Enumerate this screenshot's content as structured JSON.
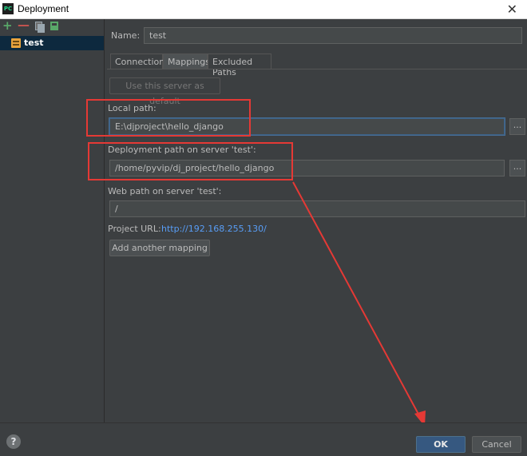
{
  "window": {
    "title": "Deployment",
    "app_icon_text": "PC",
    "close_glyph": "✕"
  },
  "toolbar": {
    "add": "+",
    "remove": "—"
  },
  "tree": {
    "items": [
      {
        "label": "test"
      }
    ]
  },
  "name": {
    "label": "Name:",
    "value": "test"
  },
  "tabs": [
    {
      "label": "Connection",
      "selected": false
    },
    {
      "label": "Mappings",
      "selected": true
    },
    {
      "label": "Excluded Paths",
      "selected": false
    }
  ],
  "use_default_button": "Use this server as default",
  "local_path": {
    "label": "Local path:",
    "value": "E:\\djproject\\hello_django"
  },
  "deployment_path": {
    "label": "Deployment path on server 'test':",
    "value": "/home/pyvip/dj_project/hello_django"
  },
  "web_path": {
    "label": "Web path on server 'test':",
    "value": "/"
  },
  "project_url": {
    "label": "Project URL:",
    "value": "http://192.168.255.130/"
  },
  "add_mapping_button": "Add another mapping",
  "browse_label": "...",
  "footer": {
    "help": "?",
    "ok": "OK",
    "cancel": "Cancel"
  },
  "colors": {
    "accent": "#365880",
    "annotation": "#e53935",
    "link": "#589df6"
  }
}
